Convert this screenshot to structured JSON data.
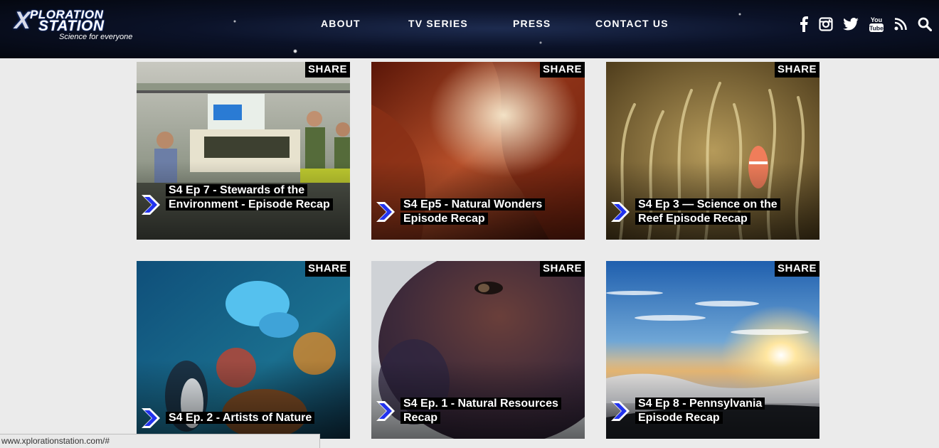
{
  "brand": {
    "x_letter": "X",
    "line1": "PLORATION",
    "line2": "STATION",
    "tagline": "Science for everyone"
  },
  "nav": {
    "about": "ABOUT",
    "tv_series": "TV SERIES",
    "press": "PRESS",
    "contact": "CONTACT US"
  },
  "social_icons": [
    "facebook-icon",
    "instagram-icon",
    "twitter-icon",
    "youtube-icon",
    "rss-icon",
    "search-icon"
  ],
  "share_label": "SHARE",
  "cards": [
    {
      "title": "S4 Ep 7 - Stewards of the Environment - Episode Recap"
    },
    {
      "title": "S4 Ep5 - Natural Wonders Episode Recap"
    },
    {
      "title": "S4 Ep 3 — Science on the Reef Episode Recap"
    },
    {
      "title": "S4 Ep. 2 - Artists of Nature"
    },
    {
      "title": "S4 Ep. 1 - Natural Resources Recap"
    },
    {
      "title": "S4 Ep 8 - Pennsylvania Episode Recap"
    }
  ],
  "status_bar": {
    "url": "www.xplorationstation.com/#"
  },
  "colors": {
    "accent_arrow": "#2233ee",
    "header_bg": "#0b1228",
    "page_bg": "#ebebeb"
  }
}
